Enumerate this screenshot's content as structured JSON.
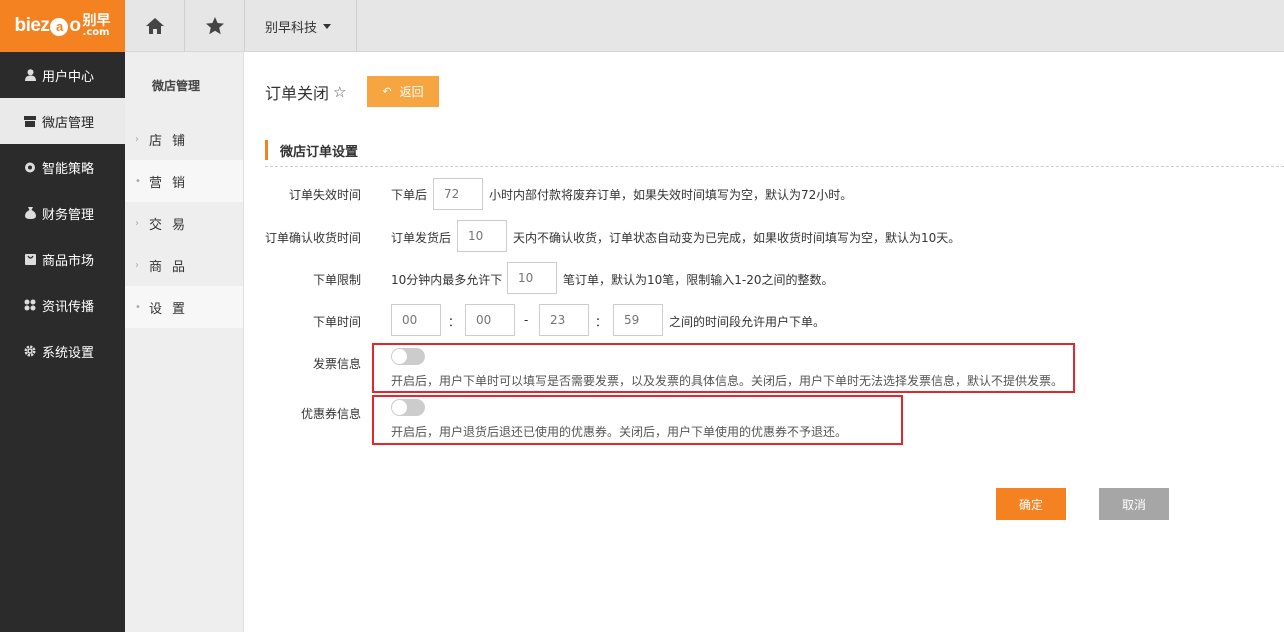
{
  "logo": {
    "brand_pre": "biez",
    "brand_bubble": "a",
    "brand_post": "o",
    "cn": "别早",
    "domain": ".com"
  },
  "sidebar": {
    "items": [
      {
        "label": "用户中心",
        "icon": "user-icon"
      },
      {
        "label": "微店管理",
        "icon": "store-icon",
        "active": true
      },
      {
        "label": "智能策略",
        "icon": "strategy-icon"
      },
      {
        "label": "财务管理",
        "icon": "money-bag-icon"
      },
      {
        "label": "商品市场",
        "icon": "market-icon"
      },
      {
        "label": "资讯传播",
        "icon": "grid-icon"
      },
      {
        "label": "系统设置",
        "icon": "gear-icon"
      }
    ]
  },
  "topbar": {
    "company": "别早科技"
  },
  "subnav": {
    "title": "微店管理",
    "items": [
      {
        "label": "店铺",
        "mark": "›"
      },
      {
        "label": "营销",
        "mark": "•"
      },
      {
        "label": "交易",
        "mark": "›"
      },
      {
        "label": "商品",
        "mark": "›"
      },
      {
        "label": "设置",
        "mark": "•"
      }
    ]
  },
  "page": {
    "title": "订单关闭",
    "back": "返回"
  },
  "section": {
    "title": "微店订单设置"
  },
  "form": {
    "expire": {
      "label": "订单失效时间",
      "prefix": "下单后",
      "value": "72",
      "suffix": "小时内部付款将废弃订单，如果失效时间填写为空，默认为72小时。"
    },
    "confirm": {
      "label": "订单确认收货时间",
      "prefix": "订单发货后",
      "value": "10",
      "suffix": "天内不确认收货，订单状态自动变为已完成，如果收货时间填写为空，默认为10天。"
    },
    "limit": {
      "label": "下单限制",
      "prefix": "10分钟内最多允许下",
      "value": "10",
      "suffix": "笔订单，默认为10笔，限制输入1-20之间的整数。"
    },
    "time": {
      "label": "下单时间",
      "start_h": "00",
      "start_m": "00",
      "end_h": "23",
      "end_m": "59",
      "colon": "：",
      "dash": "-",
      "suffix": "之间的时间段允许用户下单。"
    },
    "invoice": {
      "label": "发票信息",
      "hint": "开启后，用户下单时可以填写是否需要发票，以及发票的具体信息。关闭后，用户下单时无法选择发票信息，默认不提供发票。"
    },
    "coupon": {
      "label": "优惠券信息",
      "hint": "开启后，用户退货后退还已使用的优惠券。关闭后，用户下单使用的优惠券不予退还。"
    }
  },
  "actions": {
    "ok": "确定",
    "cancel": "取消"
  },
  "colors": {
    "accent": "#f58220",
    "sidebar": "#2b2b2b",
    "highlight": "#e0282e"
  }
}
